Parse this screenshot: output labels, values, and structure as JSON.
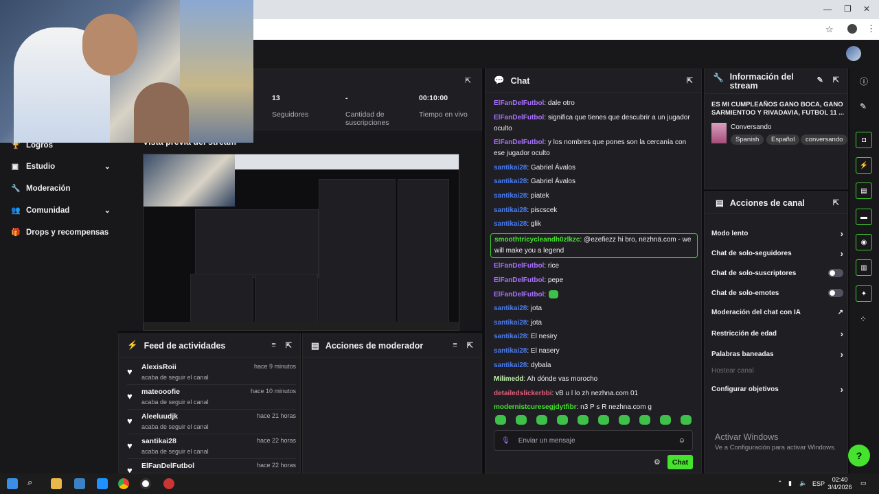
{
  "stats": {
    "followers_value": "13",
    "followers_label": "Seguidores",
    "subs_value": "-",
    "subs_label": "Cantidad de suscripciones",
    "time_value": "00:10:00",
    "time_label": "Tiempo en vivo"
  },
  "preview": {
    "title": "Vista previa del stream"
  },
  "sidebar": {
    "items": [
      {
        "label": "Logros",
        "icon": "trophy-icon"
      },
      {
        "label": "Estudio",
        "icon": "studio-icon"
      },
      {
        "label": "Moderación",
        "icon": "wrench-icon"
      },
      {
        "label": "Comunidad",
        "icon": "community-icon"
      },
      {
        "label": "Drops y recompensas",
        "icon": "gift-icon"
      }
    ]
  },
  "feed": {
    "title": "Feed de actividades",
    "items": [
      {
        "name": "AlexisRoii",
        "action": "acaba de seguir el canal",
        "time": "hace 9 minutos"
      },
      {
        "name": "mateooofie",
        "action": "acaba de seguir el canal",
        "time": "hace 10 minutos"
      },
      {
        "name": "Aleeluudjk",
        "action": "acaba de seguir el canal",
        "time": "hace 21 horas"
      },
      {
        "name": "santikai28",
        "action": "acaba de seguir el canal",
        "time": "hace 22 horas"
      },
      {
        "name": "ElFanDelFutbol",
        "action": "",
        "time": "hace 22 horas"
      }
    ]
  },
  "mod_actions": {
    "title": "Acciones de moderador"
  },
  "chat": {
    "title": "Chat",
    "messages": [
      {
        "user": "ElFanDelFutbol",
        "text": ": dale otro",
        "color": "#a970ff"
      },
      {
        "user": "ElFanDelFutbol",
        "text": ": significa que tienes que descubrir a un jugador oculto",
        "color": "#a970ff"
      },
      {
        "user": "ElFanDelFutbol",
        "text": ": y los nombres que pones son la cercanía con ese jugador oculto",
        "color": "#a970ff"
      },
      {
        "user": "santikai28",
        "text": ": Gabriel Ávalos",
        "color": "#4a7cf0"
      },
      {
        "user": "santikai28",
        "text": ": Gabriel Ávalos",
        "color": "#4a7cf0"
      },
      {
        "user": "santikai28",
        "text": ": piatek",
        "color": "#4a7cf0"
      },
      {
        "user": "santikai28",
        "text": ": piscscek",
        "color": "#4a7cf0"
      },
      {
        "user": "santikai28",
        "text": ": glik",
        "color": "#4a7cf0"
      },
      {
        "user": "smoothtricycleandh0zlkzc",
        "text": ": @ezefiezz hi bro, nëzhnä.com - we will make you a legend",
        "color": "#45e32d",
        "highlight": true
      },
      {
        "user": "ElFanDelFutbol",
        "text": ": rice",
        "color": "#a970ff"
      },
      {
        "user": "ElFanDelFutbol",
        "text": ": pepe",
        "color": "#a970ff"
      },
      {
        "user": "ElFanDelFutbol",
        "text": ":",
        "color": "#a970ff",
        "emote": true
      },
      {
        "user": "santikai28",
        "text": ": jota",
        "color": "#4a7cf0"
      },
      {
        "user": "santikai28",
        "text": ": jota",
        "color": "#4a7cf0"
      },
      {
        "user": "santikai28",
        "text": ": El nesiry",
        "color": "#4a7cf0"
      },
      {
        "user": "santikai28",
        "text": ": El nasery",
        "color": "#4a7cf0"
      },
      {
        "user": "santikai28",
        "text": ": dybala",
        "color": "#4a7cf0"
      },
      {
        "user": "Milimedd",
        "text": ": Ah dónde vas morocho",
        "color": "#c4f2b0"
      },
      {
        "user": "detailedslickerbbi",
        "text": ": vB u l lo zh nezhna.com 01",
        "color": "#e0607e"
      },
      {
        "user": "modernistcuresegjdytfibr",
        "text": ": n3 P s R nezhna.com g",
        "color": "#45e32d"
      }
    ],
    "input_placeholder": "Enviar un mensaje",
    "send_label": "Chat"
  },
  "stream_info": {
    "title": "Información del stream",
    "stream_title": "ES MI CUMPLEAÑOS GANO BOCA, GANO SARMIENTOO Y RIVADAVIA, FUTBOL 11 ...",
    "category": "Conversando",
    "tags": [
      "Spanish",
      "Español",
      "conversando"
    ]
  },
  "channel_actions": {
    "title": "Acciones de canal",
    "items": [
      {
        "label": "Modo lento",
        "control": "chevron"
      },
      {
        "label": "Chat de solo-seguidores",
        "control": "chevron"
      },
      {
        "label": "Chat de solo-suscriptores",
        "control": "toggle"
      },
      {
        "label": "Chat de solo-emotes",
        "control": "toggle"
      },
      {
        "label": "Moderación del chat con IA",
        "control": "external"
      },
      {
        "label": "Restricción de edad",
        "control": "chevron"
      },
      {
        "label": "Palabras baneadas",
        "control": "chevron"
      },
      {
        "label": "Hostear canal",
        "control": "none"
      },
      {
        "label": "Configurar objetivos",
        "control": "chevron"
      }
    ]
  },
  "watermark": {
    "line1": "Activar Windows",
    "line2": "Ve a Configuración para activar Windows."
  },
  "taskbar": {
    "lang": "ESP",
    "time": "02:40",
    "date": "3/4/2026"
  },
  "colors": {
    "accent": "#45e32d",
    "bg": "#0e0e10",
    "panel": "#1f1f23"
  }
}
